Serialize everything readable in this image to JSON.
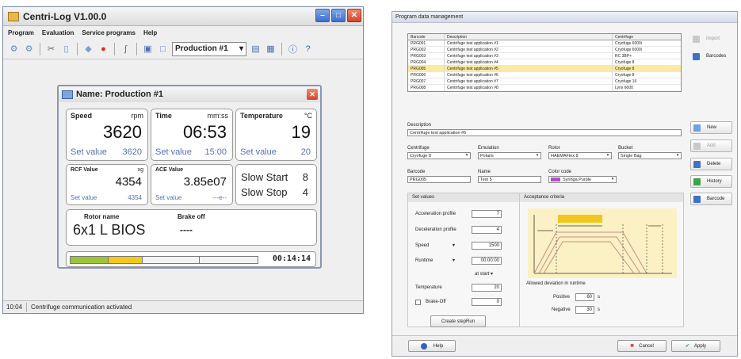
{
  "left_app": {
    "title": "Centri-Log V1.00.0",
    "menu": [
      "Program",
      "Evaluation",
      "Service programs",
      "Help"
    ],
    "production_select": "Production #1",
    "status": {
      "time": "10:04",
      "message": "Centrifuge communication activated"
    },
    "dialog": {
      "title": "Name: Production #1",
      "speed": {
        "label": "Speed",
        "unit": "rpm",
        "value": "3620",
        "set_label": "Set value",
        "set_value": "3620"
      },
      "time": {
        "label": "Time",
        "unit": "mm:ss",
        "value": "06:53",
        "set_label": "Set value",
        "set_value": "15:00"
      },
      "temperature": {
        "label": "Temperature",
        "unit": "°C",
        "value": "19",
        "set_label": "Set value",
        "set_value": "20"
      },
      "rcf": {
        "label": "RCF Value",
        "unit": "xg",
        "value": "4354",
        "set_label": "Set value",
        "set_value": "4354"
      },
      "ace": {
        "label": "ACE Value",
        "value": "3.85e07",
        "set_label": "Set value",
        "set_value": "---e--"
      },
      "slow_start": {
        "label": "Slow Start",
        "value": "8"
      },
      "slow_stop": {
        "label": "Slow Stop",
        "value": "4"
      },
      "rotor": {
        "label": "Rotor name",
        "value": "6x1 L BIOS"
      },
      "brake": {
        "label": "Brake off",
        "value": "----"
      },
      "progress_time": "00:14:14"
    }
  },
  "right_app": {
    "title": "Program data management",
    "table": {
      "headers": [
        "Barcode",
        "Description",
        "Centrifuge"
      ],
      "rows": [
        [
          "PRG001",
          "Centrifuge test application #1",
          "Cryofuge 6000i"
        ],
        [
          "PRG002",
          "Centrifuge test application #2",
          "Cryofuge 6000i"
        ],
        [
          "PRG003",
          "Centrifuge test application #3",
          "RC 3BP+"
        ],
        [
          "PRG004",
          "Centrifuge test application #4",
          "Cryofuge 8"
        ],
        [
          "PRG005",
          "Centrifuge test application #5",
          "Cryofuge 8"
        ],
        [
          "PRG006",
          "Centrifuge test application #6",
          "Cryofuge 8"
        ],
        [
          "PRG007",
          "Centrifuge test application #7",
          "Cryofuge 16"
        ],
        [
          "PRG008",
          "Centrifuge test application #8",
          "Lynx 6000"
        ]
      ],
      "selected_row": 4
    },
    "side_buttons": {
      "import": "Import",
      "barcodes": "Barcodes",
      "new": "New",
      "add": "Add",
      "delete": "Delete",
      "history": "History",
      "barcode": "Barcode"
    },
    "form": {
      "description_label": "Description",
      "description_value": "Centrifuge test application #5",
      "centrifuge_label": "Centrifuge",
      "centrifuge_value": "Cryofuge 8",
      "emulation_label": "Emulation",
      "emulation_value": "Polaris",
      "rotor_label": "Rotor",
      "rotor_value": "HAEMAFlex 8",
      "bucket_label": "Bucket",
      "bucket_value": "Single Bag",
      "barcode_label": "Barcode",
      "barcode_value": "PRG005",
      "name_label": "Name",
      "name_value": "Test 5",
      "color_label": "Color code",
      "color_value": "Syringa Purple"
    },
    "set_values": {
      "title": "Set values",
      "accel_label": "Acceleration profile",
      "accel_value": "7",
      "decel_label": "Deceleration profile",
      "decel_value": "4",
      "speed_label": "Speed",
      "speed_value": "1500",
      "runtime_label": "Runtime",
      "runtime_value": "00:00:00",
      "at_start": "at start",
      "temp_label": "Temperature",
      "temp_value": "20",
      "brake_label": "Brake-Off",
      "brake_value": "0",
      "create_button": "Create stepRun"
    },
    "acceptance": {
      "title": "Acceptance criteria",
      "deviation_label": "Allowed deviation in runtime",
      "positive_label": "Positive",
      "positive_value": "60",
      "positive_unit": "s",
      "negative_label": "Negative",
      "negative_value": "30",
      "negative_unit": "s"
    },
    "footer": {
      "help": "Help",
      "cancel": "Cancel",
      "apply": "Apply"
    }
  }
}
